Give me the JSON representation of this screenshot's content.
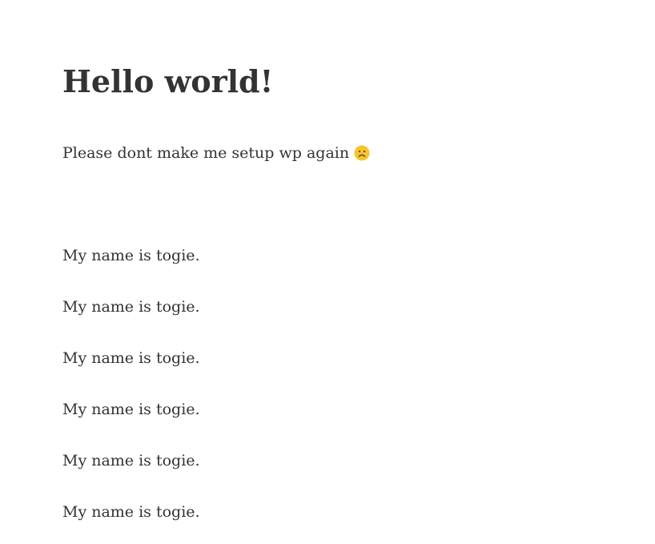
{
  "post": {
    "title": "Hello world!",
    "intro_text": "Please dont make me setup wp again",
    "intro_icon": "sad-face-icon",
    "lines": [
      "My name is togie.",
      "My name is togie.",
      "My name is togie.",
      "My name is togie.",
      "My name is togie.",
      "My name is togie."
    ]
  },
  "colors": {
    "text": "#333333",
    "background": "#ffffff",
    "emoji_face": "#f7c52a",
    "emoji_features": "#5a4a2a"
  }
}
